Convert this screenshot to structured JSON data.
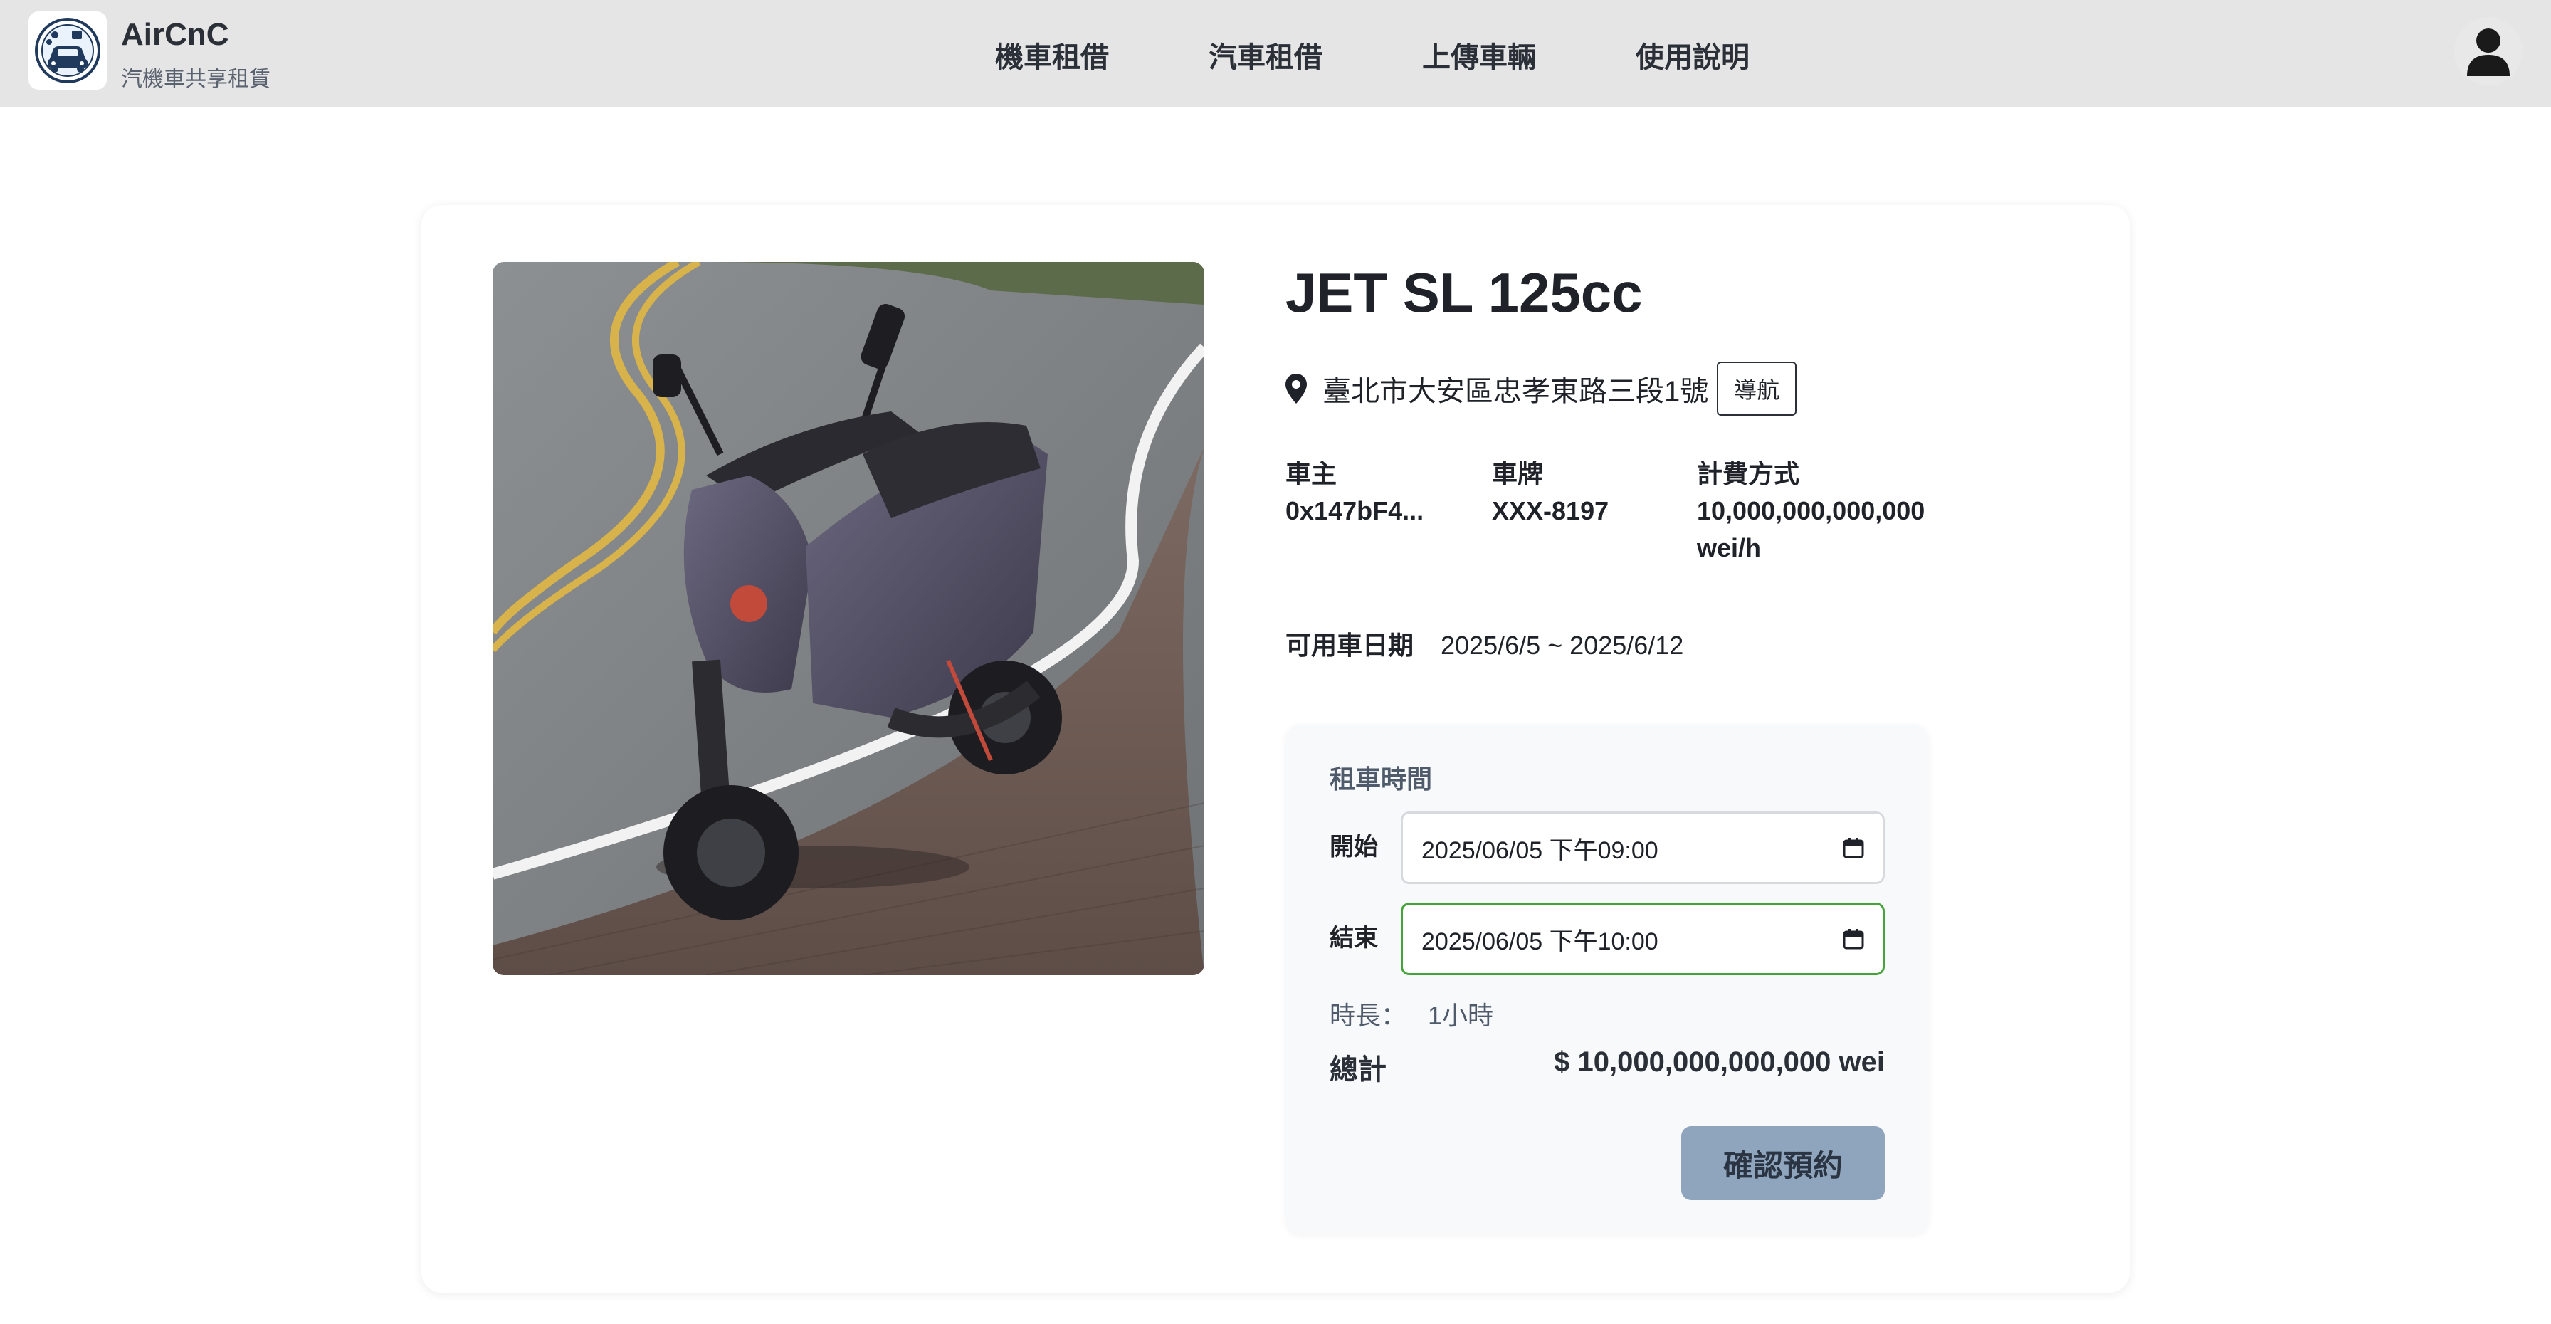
{
  "header": {
    "brand_title": "AirCnC",
    "brand_subtitle": "汽機車共享租賃",
    "nav": [
      "機車租借",
      "汽車租借",
      "上傳車輛",
      "使用說明"
    ]
  },
  "vehicle": {
    "name": "JET SL 125cc",
    "address": "臺北市大安區忠孝東路三段1號",
    "navigate_label": "導航",
    "owner_label": "車主",
    "owner_value": "0x147bF4...",
    "plate_label": "車牌",
    "plate_value": "XXX-8197",
    "billing_label": "計費方式",
    "billing_value": "10,000,000,000,000\nwei/h",
    "available_label": "可用車日期",
    "available_value": "2025/6/5 ~ 2025/6/12"
  },
  "rental": {
    "title": "租車時間",
    "start_label": "開始",
    "start_value": "2025/06/05 下午09:00",
    "end_label": "結束",
    "end_value": "2025/06/05 下午10:00",
    "duration_label": "時長：",
    "duration_value": "1小時",
    "total_label": "總計",
    "total_value": "$ 10,000,000,000,000 wei",
    "confirm_label": "確認預約"
  },
  "icons": {
    "logo": "car-share-logo-icon",
    "avatar": "user-icon",
    "location": "map-pin-icon",
    "calendar": "calendar-icon"
  },
  "colors": {
    "navbar_bg": "#e5e5e5",
    "active_border": "#45a33a",
    "confirm_bg": "#8ea5bd"
  }
}
